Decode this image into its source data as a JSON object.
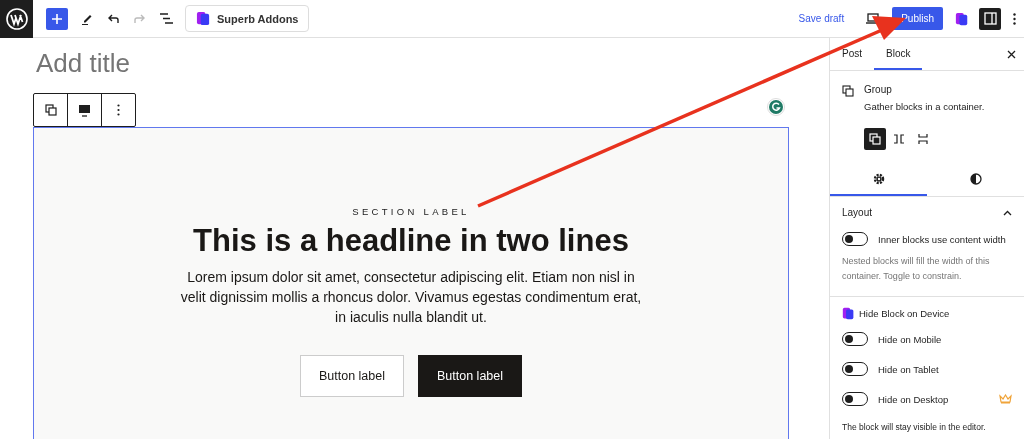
{
  "topbar": {
    "addon_button": "Superb Addons",
    "save_draft": "Save draft",
    "publish": "Publish",
    "settings_open": true
  },
  "editor": {
    "title_placeholder": "Add title",
    "section_label": "SECTION LABEL",
    "headline": "This is a headline in two lines",
    "body": "Lorem ipsum dolor sit amet, consectetur adipiscing elit. Etiam non nisl in velit dignissim mollis a rhoncus dolor. Vivamus egestas condimentum erat, in iaculis nulla blandit ut.",
    "buttons": [
      {
        "label": "Button label",
        "kind": "outline"
      },
      {
        "label": "Button label",
        "kind": "solid"
      }
    ]
  },
  "sidebar": {
    "tabs": [
      {
        "label": "Post",
        "selected": false
      },
      {
        "label": "Block",
        "selected": true
      }
    ],
    "block": {
      "name": "Group",
      "description": "Gather blocks in a container."
    },
    "variations": [
      {
        "kind": "group",
        "selected": true
      },
      {
        "kind": "row",
        "selected": false
      },
      {
        "kind": "stack",
        "selected": false
      }
    ],
    "inspector_tabs": [
      {
        "kind": "settings",
        "selected": true
      },
      {
        "kind": "styles",
        "selected": false
      }
    ],
    "layout": {
      "title": "Layout",
      "expanded": true,
      "toggle": {
        "label": "Inner blocks use content width",
        "on": false
      },
      "help": "Nested blocks will fill the width of this container. Toggle to constrain."
    },
    "device": {
      "title": "Hide Block on Device",
      "toggles": [
        {
          "label": "Hide on Mobile",
          "on": false,
          "premium": false
        },
        {
          "label": "Hide on Tablet",
          "on": false,
          "premium": false
        },
        {
          "label": "Hide on Desktop",
          "on": false,
          "premium": true
        }
      ],
      "note": "The block will stay visible in the editor."
    }
  }
}
